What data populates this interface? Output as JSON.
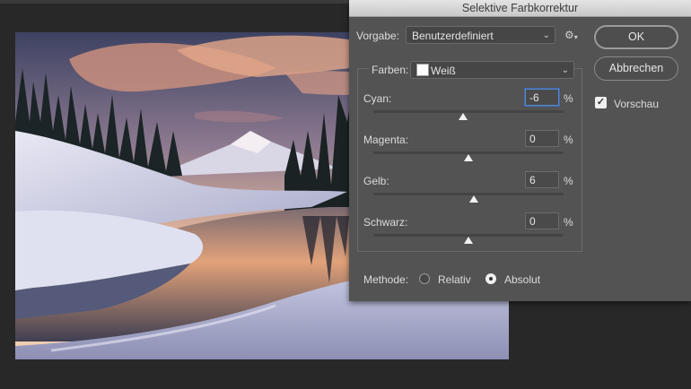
{
  "dialog": {
    "title": "Selektive Farbkorrektur",
    "preset_label": "Vorgabe:",
    "preset_value": "Benutzerdefiniert",
    "colors_label": "Farben:",
    "colors_value": "Weiß",
    "ok_label": "OK",
    "cancel_label": "Abbrechen",
    "preview_label": "Vorschau",
    "preview_checked": true,
    "percent_symbol": "%",
    "sliders": [
      {
        "label": "Cyan:",
        "value": "-6",
        "fraction": 0.47
      },
      {
        "label": "Magenta:",
        "value": "0",
        "fraction": 0.5
      },
      {
        "label": "Gelb:",
        "value": "6",
        "fraction": 0.53
      },
      {
        "label": "Schwarz:",
        "value": "0",
        "fraction": 0.5
      }
    ],
    "method_label": "Methode:",
    "method_options": [
      "Relativ",
      "Absolut"
    ],
    "method_selected": "Absolut"
  },
  "icons": {
    "gear": "gear-icon",
    "chevron": "chevron-down-icon",
    "check": "checkmark-icon"
  },
  "colors": {
    "dialog_bg": "#535353",
    "titlebar": "#d6d6d6",
    "canvas_bg": "#282828",
    "focus_ring": "#5b87c8"
  }
}
